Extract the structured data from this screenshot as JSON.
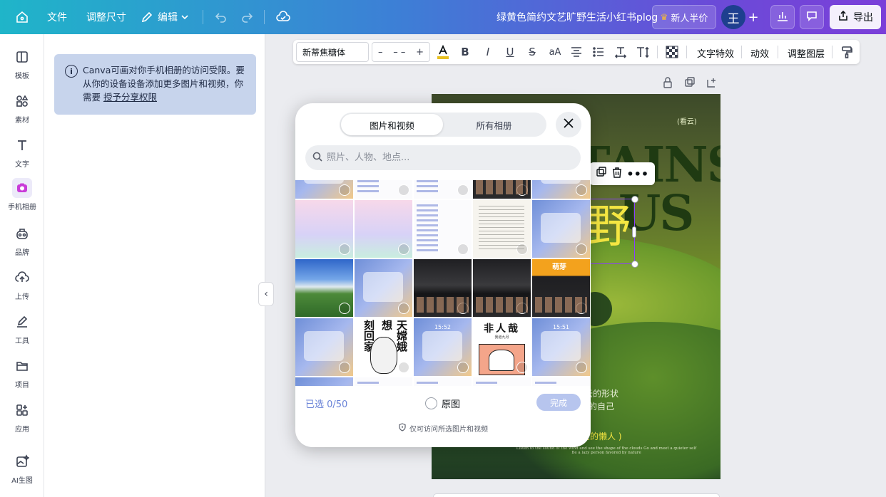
{
  "topbar": {
    "file_label": "文件",
    "resize_label": "调整尺寸",
    "edit_label": "编辑",
    "doc_title": "绿黄色简约文艺旷野生活小红书plog",
    "promo_label": "新人半价",
    "avatar_initial": "王",
    "export_label": "导出",
    "gradient_start": "#1fb5c9",
    "gradient_end": "#7b3fd9"
  },
  "sidebar": {
    "items": [
      {
        "label": "模板",
        "icon": "template-icon"
      },
      {
        "label": "素材",
        "icon": "elements-icon"
      },
      {
        "label": "文字",
        "icon": "text-icon"
      },
      {
        "label": "手机相册",
        "icon": "phone-album-icon"
      },
      {
        "label": "品牌",
        "icon": "brand-icon"
      },
      {
        "label": "上传",
        "icon": "upload-icon"
      },
      {
        "label": "工具",
        "icon": "draw-tool-icon"
      },
      {
        "label": "项目",
        "icon": "folder-icon"
      },
      {
        "label": "应用",
        "icon": "apps-icon"
      },
      {
        "label": "AI生图",
        "icon": "ai-image-icon"
      }
    ],
    "active_index": 3
  },
  "panel": {
    "notice_text": "Canva可画对你手机相册的访问受限。要从你的设备设备添加更多图片和视频，你需要",
    "notice_link": "授予分享权限"
  },
  "text_toolbar": {
    "font_name": "新蒂焦糖体",
    "font_size": "– –",
    "effects_label": "文字特效",
    "animate_label": "动效",
    "layers_label": "调整图层"
  },
  "canvas": {
    "tag_text": "(看云)",
    "big_line1": "TAINS",
    "big_line2": "US",
    "calligraphy": "野",
    "line1": "云的形状",
    "line2": "的自己",
    "yellow_line": "爱的懒人 )",
    "tiny_line1": "Listen to the sound of the wind and see the shape of the clouds Go and meet a quieter self",
    "tiny_line2": "Be a lazy person favored by nature"
  },
  "modal": {
    "tabs": [
      "图片和视频",
      "所有相册"
    ],
    "active_tab": 0,
    "search_placeholder": "照片、人物、地点...",
    "selected_count": "已选 0/50",
    "original_label": "原图",
    "done_label": "完成",
    "privacy_text": "仅可访问所选图片和视频",
    "thumb_texts": {
      "clock1": "15:52",
      "clock2": "15:51",
      "comic_title": "非人哉",
      "comic_sub": "我道九月",
      "rabbit_chars": [
        "天嫦娥",
        "想",
        "刻回家"
      ],
      "photo_label": "萌芽"
    }
  }
}
